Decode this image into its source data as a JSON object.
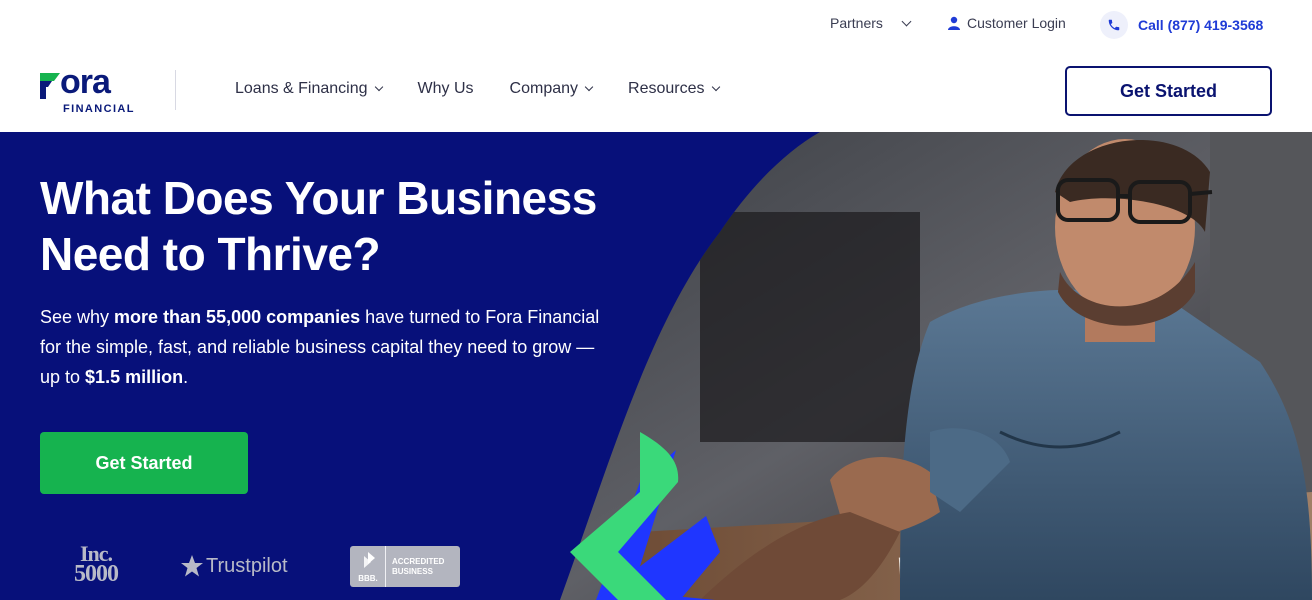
{
  "utility": {
    "partners": "Partners",
    "customer_login": "Customer Login",
    "call": "Call (877) 419-3568"
  },
  "header": {
    "logo_word": "ora",
    "logo_sub": "FINANCIAL",
    "nav": [
      "Loans & Financing",
      "Why Us",
      "Company",
      "Resources"
    ],
    "cta": "Get Started"
  },
  "hero": {
    "title": "What Does Your Business Need to Thrive?",
    "text_1": "See why ",
    "text_bold_1": "more than 55,000 companies",
    "text_2": " have turned to Fora Financial for the simple, fast, and reliable business capital they need to grow — up to ",
    "text_bold_2": "$1.5 million",
    "text_3": ".",
    "cta": "Get Started"
  },
  "badges": {
    "inc_line1": "Inc.",
    "inc_line2": "5000",
    "trustpilot": "Trustpilot",
    "bbb_short": "BBB.",
    "bbb_line1": "ACCREDITED",
    "bbb_line2": "BUSINESS"
  },
  "icons": {
    "chevron": "chevron-down-icon",
    "user": "user-icon",
    "phone": "phone-icon",
    "star": "star-icon"
  },
  "colors": {
    "brand_navy": "#07107a",
    "brand_green": "#16b34f",
    "accent_blue": "#1f3bd6",
    "shape_green": "#3ad97a"
  }
}
